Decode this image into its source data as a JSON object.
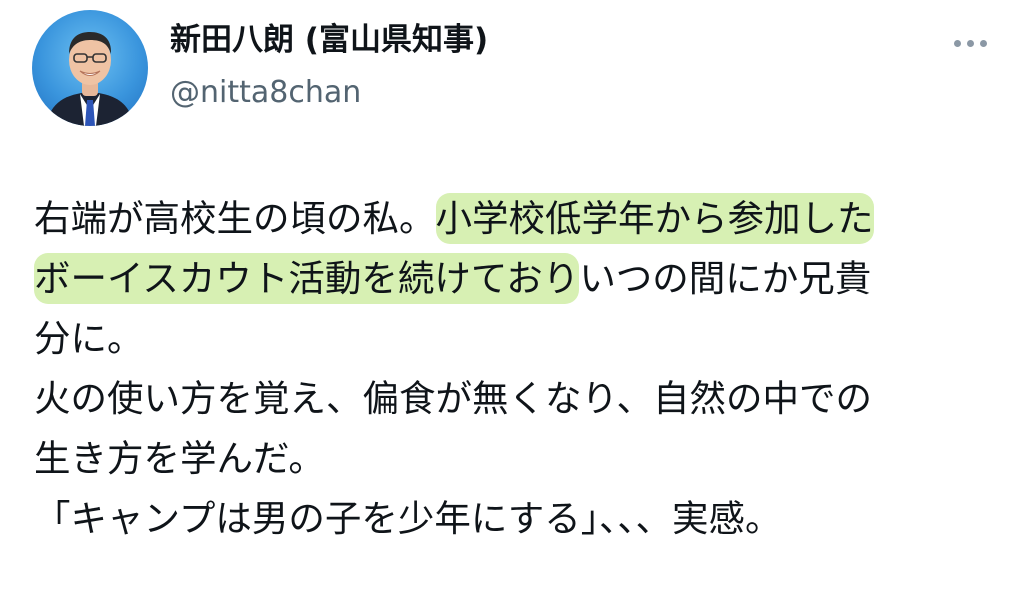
{
  "tweet": {
    "author": {
      "display_name": "新田八朗 (富山県知事)",
      "handle": "@nitta8chan",
      "avatar_icon": "person-avatar-icon"
    },
    "more_icon": "more-horizontal-icon",
    "body_lines": [
      {
        "plain": "右端が高校生の頃の私。",
        "highlight": "小学校低学年から参加した",
        "after": ""
      },
      {
        "plain": "",
        "highlight": "ボーイスカウト活動を続けており",
        "after": "いつの間にか兄貴"
      },
      {
        "plain": "分に。",
        "highlight": "",
        "after": ""
      },
      {
        "plain": "火の使い方を覚え、偏食が無くなり、自然の中での",
        "highlight": "",
        "after": ""
      },
      {
        "plain": "生き方を学んだ。",
        "highlight": "",
        "after": ""
      },
      {
        "plain": "「キャンプは男の子を少年にする」、、、実感。",
        "highlight": "",
        "after": ""
      }
    ],
    "highlight_color": "#d7f0b3",
    "text_color": "#0f1419",
    "secondary_text_color": "#536471"
  }
}
